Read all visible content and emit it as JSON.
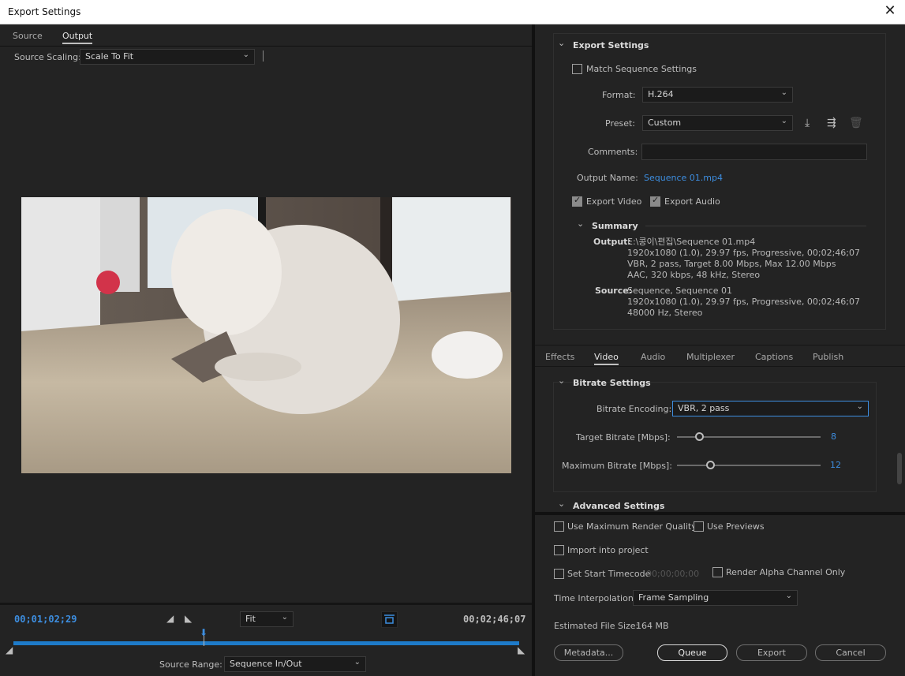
{
  "window": {
    "title": "Export Settings",
    "close": "✕"
  },
  "left_panel": {
    "tabs": [
      "Source",
      "Output"
    ],
    "source_scaling": {
      "label": "Source Scaling:",
      "value": "Scale To Fit"
    },
    "timeline": {
      "current_time": "00;01;02;29",
      "end_time": "00;02;46;07",
      "zoom": "Fit",
      "source_range_label": "Source Range:",
      "source_range_value": "Sequence In/Out"
    }
  },
  "export_settings": {
    "header": "Export Settings",
    "match_sequence": "Match Sequence Settings",
    "format_label": "Format:",
    "format_value": "H.264",
    "preset_label": "Preset:",
    "preset_value": "Custom",
    "comments_label": "Comments:",
    "comments_value": "",
    "output_name_label": "Output Name:",
    "output_name_value": "Sequence 01.mp4",
    "export_video": "Export Video",
    "export_audio": "Export Audio",
    "summary_header": "Summary",
    "summary_output_label": "Output:",
    "summary_output_lines": [
      "E:\\콩이\\편집\\Sequence 01.mp4",
      "1920x1080 (1.0), 29.97 fps, Progressive, 00;02;46;07",
      "VBR, 2 pass, Target 8.00 Mbps, Max 12.00 Mbps",
      "AAC, 320 kbps, 48 kHz, Stereo"
    ],
    "summary_source_label": "Source:",
    "summary_source_lines": [
      "Sequence, Sequence 01",
      "1920x1080 (1.0), 29.97 fps, Progressive, 00;02;46;07",
      "48000 Hz, Stereo"
    ]
  },
  "settings_tabs": [
    "Effects",
    "Video",
    "Audio",
    "Multiplexer",
    "Captions",
    "Publish"
  ],
  "bitrate": {
    "header": "Bitrate Settings",
    "encoding_label": "Bitrate Encoding:",
    "encoding_value": "VBR, 2 pass",
    "target_label": "Target Bitrate [Mbps]:",
    "target_value": "8",
    "max_label": "Maximum Bitrate [Mbps]:",
    "max_value": "12",
    "advanced_header": "Advanced Settings"
  },
  "bottom": {
    "use_max_render": "Use Maximum Render Quality",
    "use_previews": "Use Previews",
    "import_project": "Import into project",
    "set_start_timecode": "Set Start Timecode",
    "start_timecode_value": "00;00;00;00",
    "render_alpha": "Render Alpha Channel Only",
    "time_interp_label": "Time Interpolation:",
    "time_interp_value": "Frame Sampling",
    "file_size_label": "Estimated File Size:",
    "file_size_value": "164 MB",
    "buttons": {
      "metadata": "Metadata...",
      "queue": "Queue",
      "export": "Export",
      "cancel": "Cancel"
    }
  },
  "colors": {
    "accent": "#3d8ee0",
    "panel": "#232323",
    "timeline_bar": "#1e7bc9"
  }
}
